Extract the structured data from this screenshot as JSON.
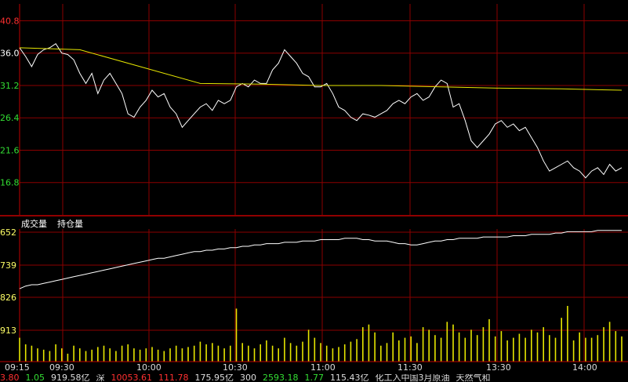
{
  "colors": {
    "background": "#000000",
    "grid": "#8b0000",
    "frame": "#c00000",
    "price_line": "#ffffff",
    "avg_line": "#e6e600",
    "volume_bar": "#e6e600",
    "oi_line": "#ffffff",
    "axis_up": "#ff3030",
    "axis_mid": "#ffffff",
    "axis_down": "#33dd33",
    "axis_lower": "#ffff66",
    "time_text": "#dddddd"
  },
  "panel_labels": {
    "volume": "成交量",
    "open_interest": "持仓量"
  },
  "chart_data": [
    {
      "type": "line",
      "panel": "price",
      "y_ticks": [
        "40.8",
        "36.0",
        "31.2",
        "26.4",
        "21.6",
        "16.8"
      ],
      "y_tick_values": [
        40.8,
        36.0,
        31.2,
        26.4,
        21.6,
        16.8
      ],
      "ylim": [
        12.0,
        43.3
      ],
      "xlim": [
        0,
        100
      ],
      "series": [
        {
          "role": "price",
          "x": [
            0,
            1,
            2,
            3,
            4,
            5,
            6,
            7,
            8,
            9,
            10,
            11,
            12,
            13,
            14,
            15,
            16,
            17,
            18,
            19,
            20,
            21,
            22,
            23,
            24,
            25,
            26,
            27,
            28,
            29,
            30,
            31,
            32,
            33,
            34,
            35,
            36,
            37,
            38,
            39,
            40,
            41,
            42,
            43,
            44,
            45,
            46,
            47,
            48,
            49,
            50,
            51,
            52,
            53,
            54,
            55,
            56,
            57,
            58,
            59,
            60,
            61,
            62,
            63,
            64,
            65,
            66,
            67,
            68,
            69,
            70,
            71,
            72,
            73,
            74,
            75,
            76,
            77,
            78,
            79,
            80,
            81,
            82,
            83,
            84,
            85,
            86,
            87,
            88,
            89,
            90,
            91,
            92,
            93,
            94,
            95,
            96,
            97,
            98,
            99,
            100
          ],
          "values": [
            36.8,
            35.5,
            34.0,
            35.8,
            36.5,
            36.8,
            37.4,
            36.0,
            35.8,
            35.0,
            33.0,
            31.5,
            33.0,
            30.0,
            32.0,
            33.0,
            31.5,
            30.0,
            27.0,
            26.5,
            28.0,
            29.0,
            30.5,
            29.5,
            30.0,
            28.0,
            27.0,
            25.0,
            26.0,
            27.0,
            28.0,
            28.5,
            27.5,
            29.0,
            28.5,
            29.0,
            31.0,
            31.5,
            31.0,
            32.0,
            31.5,
            31.5,
            33.5,
            34.5,
            36.5,
            35.5,
            34.5,
            33.0,
            32.5,
            31.0,
            31.0,
            31.5,
            30.0,
            28.0,
            27.5,
            26.5,
            26.0,
            27.0,
            26.8,
            26.5,
            27.0,
            27.5,
            28.5,
            29.0,
            28.5,
            29.5,
            30.0,
            29.0,
            29.5,
            31.0,
            32.0,
            31.5,
            28.0,
            28.5,
            26.0,
            23.0,
            22.0,
            23.0,
            24.0,
            25.5,
            26.0,
            25.0,
            25.5,
            24.5,
            25.0,
            23.5,
            22.0,
            20.0,
            18.5,
            19.0,
            19.5,
            20.0,
            19.0,
            18.5,
            17.5,
            18.5,
            19.0,
            18.0,
            19.5,
            18.5,
            19.0
          ]
        },
        {
          "role": "average",
          "x": [
            0,
            10,
            20,
            30,
            40,
            50,
            60,
            70,
            80,
            90,
            100
          ],
          "values": [
            36.8,
            36.5,
            34.0,
            31.5,
            31.4,
            31.2,
            31.2,
            31.0,
            30.8,
            30.7,
            30.5
          ]
        }
      ]
    },
    {
      "type": "bar",
      "panel": "volume",
      "labels": [
        "成交量",
        "持仓量"
      ],
      "y_ticks": [
        "652",
        "739",
        "826",
        "913"
      ],
      "x_ticks": [
        "09:15",
        "09:30",
        "10:00",
        "10:30",
        "11:00",
        "11:30",
        "13:30",
        "14:00"
      ],
      "ylim": [
        0,
        100
      ],
      "volume": [
        18,
        13,
        12,
        10,
        9,
        8,
        13,
        10,
        6,
        12,
        10,
        8,
        9,
        11,
        12,
        10,
        8,
        12,
        13,
        10,
        9,
        10,
        11,
        9,
        8,
        10,
        12,
        10,
        11,
        12,
        15,
        13,
        14,
        12,
        10,
        12,
        40,
        14,
        12,
        10,
        13,
        16,
        12,
        10,
        18,
        14,
        12,
        15,
        24,
        18,
        14,
        12,
        10,
        11,
        13,
        15,
        17,
        26,
        28,
        22,
        12,
        14,
        22,
        16,
        18,
        19,
        14,
        26,
        24,
        20,
        18,
        30,
        28,
        22,
        18,
        24,
        20,
        26,
        32,
        19,
        23,
        16,
        18,
        21,
        18,
        24,
        22,
        26,
        20,
        18,
        33,
        42,
        16,
        22,
        18,
        18,
        20,
        26,
        30,
        23,
        19
      ],
      "open_interest": [
        55,
        57,
        58,
        58,
        59,
        60,
        61,
        62,
        63,
        64,
        65,
        66,
        67,
        68,
        69,
        70,
        71,
        72,
        73,
        74,
        75,
        76,
        77,
        78,
        78,
        79,
        80,
        81,
        82,
        83,
        83,
        84,
        84,
        85,
        85,
        86,
        86,
        87,
        87,
        88,
        88,
        89,
        89,
        89,
        90,
        90,
        90,
        91,
        91,
        91,
        92,
        92,
        92,
        92,
        93,
        93,
        93,
        92,
        92,
        91,
        91,
        91,
        90,
        89,
        89,
        88,
        88,
        89,
        90,
        91,
        91,
        92,
        92,
        93,
        93,
        93,
        93,
        94,
        94,
        94,
        94,
        94,
        95,
        95,
        95,
        96,
        96,
        96,
        96,
        97,
        97,
        98,
        98,
        98,
        98,
        98,
        99,
        99,
        99,
        99,
        99
      ]
    }
  ],
  "status_bar": [
    {
      "text": "3.80",
      "color": "#ff3030"
    },
    {
      "text": "1.05",
      "color": "#33dd33"
    },
    {
      "text": "919.58亿",
      "color": "#dddddd"
    },
    {
      "text": "深",
      "color": "#dddddd"
    },
    {
      "text": "10053.61",
      "color": "#ff3030"
    },
    {
      "text": "111.78",
      "color": "#ff3030"
    },
    {
      "text": "175.95亿",
      "color": "#dddddd"
    },
    {
      "text": "300",
      "color": "#dddddd"
    },
    {
      "text": "2593.18",
      "color": "#33dd33"
    },
    {
      "text": "1.77",
      "color": "#33dd33"
    },
    {
      "text": "115.43亿",
      "color": "#dddddd"
    },
    {
      "text": "化工入中国3月原油",
      "color": "#dddddd"
    },
    {
      "text": "天然气和",
      "color": "#dddddd"
    }
  ]
}
